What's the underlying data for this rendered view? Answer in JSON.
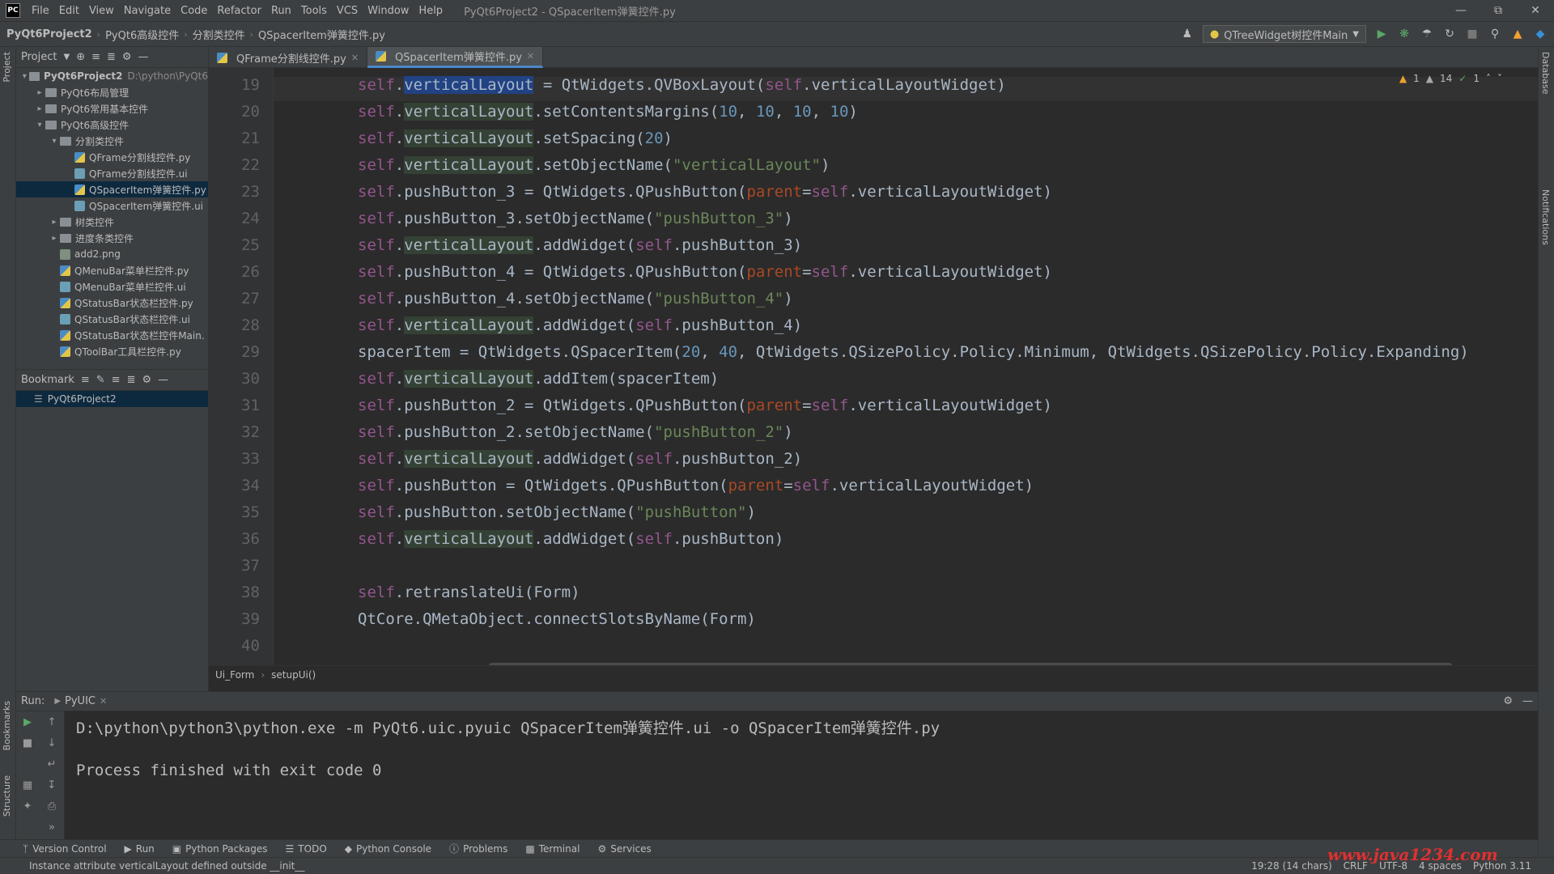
{
  "menubar": {
    "logo": "PC",
    "items": [
      "File",
      "Edit",
      "View",
      "Navigate",
      "Code",
      "Refactor",
      "Run",
      "Tools",
      "VCS",
      "Window",
      "Help"
    ],
    "title": "PyQt6Project2 - QSpacerItem弹簧控件.py"
  },
  "navbar": {
    "crumbs": [
      "PyQt6Project2",
      "PyQt6高级控件",
      "分割类控件",
      "QSpacerItem弹簧控件.py"
    ],
    "run_config": "QTreeWidget树控件Main"
  },
  "project_panel": {
    "title": "Project",
    "tree": [
      {
        "label": "PyQt6Project2",
        "path": "D:\\python\\PyQt6",
        "type": "folder",
        "level": 0,
        "expanded": true,
        "bold": true
      },
      {
        "label": "PyQt6布局管理",
        "type": "folder",
        "level": 1,
        "expanded": false
      },
      {
        "label": "PyQt6常用基本控件",
        "type": "folder",
        "level": 1,
        "expanded": false
      },
      {
        "label": "PyQt6高级控件",
        "type": "folder",
        "level": 1,
        "expanded": true
      },
      {
        "label": "分割类控件",
        "type": "folder",
        "level": 2,
        "expanded": true
      },
      {
        "label": "QFrame分割线控件.py",
        "type": "py",
        "level": 3
      },
      {
        "label": "QFrame分割线控件.ui",
        "type": "ui",
        "level": 3
      },
      {
        "label": "QSpacerItem弹簧控件.py",
        "type": "py",
        "level": 3,
        "selected": true
      },
      {
        "label": "QSpacerItem弹簧控件.ui",
        "type": "ui",
        "level": 3
      },
      {
        "label": "树类控件",
        "type": "folder",
        "level": 2,
        "expanded": false
      },
      {
        "label": "进度条类控件",
        "type": "folder",
        "level": 2,
        "expanded": false
      },
      {
        "label": "add2.png",
        "type": "png",
        "level": 2
      },
      {
        "label": "QMenuBar菜单栏控件.py",
        "type": "py",
        "level": 2
      },
      {
        "label": "QMenuBar菜单栏控件.ui",
        "type": "ui",
        "level": 2
      },
      {
        "label": "QStatusBar状态栏控件.py",
        "type": "py",
        "level": 2
      },
      {
        "label": "QStatusBar状态栏控件.ui",
        "type": "ui",
        "level": 2
      },
      {
        "label": "QStatusBar状态栏控件Main.",
        "type": "py",
        "level": 2
      },
      {
        "label": "QToolBar工具栏控件.py",
        "type": "py",
        "level": 2
      }
    ]
  },
  "bookmark_panel": {
    "title": "Bookmark",
    "items": [
      "PyQt6Project2"
    ]
  },
  "editor_tabs": [
    {
      "label": "QFrame分割线控件.py",
      "active": false
    },
    {
      "label": "QSpacerItem弹簧控件.py",
      "active": true
    }
  ],
  "editor": {
    "inspection": {
      "warnings": "1",
      "weak_warnings": "14",
      "ok": "1"
    },
    "lines": [
      {
        "n": "19",
        "code": "self.verticalLayout = QtWidgets.QVBoxLayout(self.verticalLayoutWidget)"
      },
      {
        "n": "20",
        "code": "self.verticalLayout.setContentsMargins(10, 10, 10, 10)"
      },
      {
        "n": "21",
        "code": "self.verticalLayout.setSpacing(20)"
      },
      {
        "n": "22",
        "code": "self.verticalLayout.setObjectName(\"verticalLayout\")"
      },
      {
        "n": "23",
        "code": "self.pushButton_3 = QtWidgets.QPushButton(parent=self.verticalLayoutWidget)"
      },
      {
        "n": "24",
        "code": "self.pushButton_3.setObjectName(\"pushButton_3\")"
      },
      {
        "n": "25",
        "code": "self.verticalLayout.addWidget(self.pushButton_3)"
      },
      {
        "n": "26",
        "code": "self.pushButton_4 = QtWidgets.QPushButton(parent=self.verticalLayoutWidget)"
      },
      {
        "n": "27",
        "code": "self.pushButton_4.setObjectName(\"pushButton_4\")"
      },
      {
        "n": "28",
        "code": "self.verticalLayout.addWidget(self.pushButton_4)"
      },
      {
        "n": "29",
        "code": "spacerItem = QtWidgets.QSpacerItem(20, 40, QtWidgets.QSizePolicy.Policy.Minimum, QtWidgets.QSizePolicy.Policy.Expanding)"
      },
      {
        "n": "30",
        "code": "self.verticalLayout.addItem(spacerItem)"
      },
      {
        "n": "31",
        "code": "self.pushButton_2 = QtWidgets.QPushButton(parent=self.verticalLayoutWidget)"
      },
      {
        "n": "32",
        "code": "self.pushButton_2.setObjectName(\"pushButton_2\")"
      },
      {
        "n": "33",
        "code": "self.verticalLayout.addWidget(self.pushButton_2)"
      },
      {
        "n": "34",
        "code": "self.pushButton = QtWidgets.QPushButton(parent=self.verticalLayoutWidget)"
      },
      {
        "n": "35",
        "code": "self.pushButton.setObjectName(\"pushButton\")"
      },
      {
        "n": "36",
        "code": "self.verticalLayout.addWidget(self.pushButton)"
      },
      {
        "n": "37",
        "code": ""
      },
      {
        "n": "38",
        "code": "self.retranslateUi(Form)"
      },
      {
        "n": "39",
        "code": "QtCore.QMetaObject.connectSlotsByName(Form)"
      },
      {
        "n": "40",
        "code": ""
      }
    ],
    "crumbs": [
      "Ui_Form",
      "setupUi()"
    ]
  },
  "run_panel": {
    "label": "Run:",
    "tab": "PyUIC",
    "console": [
      "D:\\python\\python3\\python.exe -m PyQt6.uic.pyuic QSpacerItem弹簧控件.ui -o QSpacerItem弹簧控件.py",
      "",
      "Process finished with exit code 0"
    ]
  },
  "bottom_tools": [
    "Version Control",
    "Run",
    "Python Packages",
    "TODO",
    "Python Console",
    "Problems",
    "Terminal",
    "Services"
  ],
  "statusbar": {
    "message": "Instance attribute verticalLayout defined outside __init__",
    "position": "19:28 (14 chars)",
    "line_sep": "CRLF",
    "encoding": "UTF-8",
    "indent": "4 spaces",
    "interpreter": "Python 3.11"
  },
  "side_tabs": {
    "left_top": "Project",
    "left_bottom_1": "Bookmarks",
    "left_bottom_2": "Structure",
    "right_1": "Database",
    "right_2": "Notifications"
  },
  "watermark": "www.java1234.com",
  "colors": {
    "background": "#2b2b2b",
    "panel": "#3c3f41",
    "self_keyword": "#94558d",
    "number": "#6897bb",
    "string": "#6a8759",
    "kwarg": "#aa4926",
    "selection": "#214283"
  }
}
